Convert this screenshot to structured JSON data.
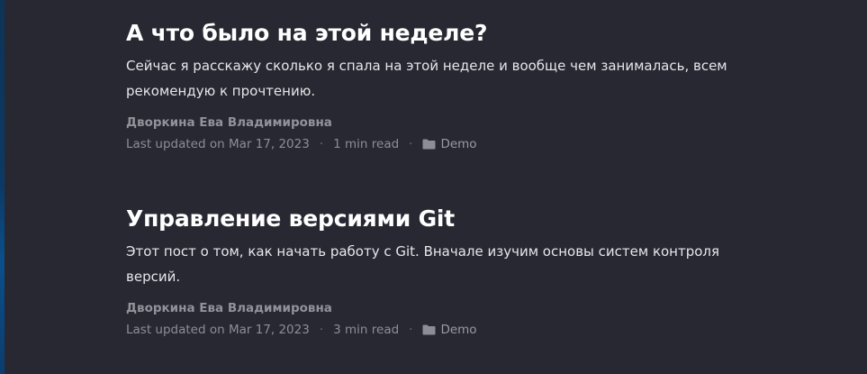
{
  "posts": [
    {
      "title": "А что было на этой неделе?",
      "excerpt": "Сейчас я расскажу сколько я спала на этой неделе и вообще чем занималась, всем рекомендую к прочтению.",
      "author": "Дворкина Ева Владимировна",
      "updated": "Last updated on Mar 17, 2023",
      "read_time": "1 min read",
      "category": "Demo",
      "separator": "·",
      "category_icon": "folder-icon"
    },
    {
      "title": "Управление версиями Git",
      "excerpt": "Этот пост о том, как начать работу с Git. Вначале изучим основы систем контроля версий.",
      "author": "Дворкина Ева Владимировна",
      "updated": "Last updated on Mar 17, 2023",
      "read_time": "3 min read",
      "category": "Demo",
      "separator": "·",
      "category_icon": "folder-icon"
    }
  ],
  "colors": {
    "background": "#272832",
    "title": "#ffffff",
    "excerpt": "#e6e6ea",
    "meta": "#8d8d95",
    "accent_edge": "#0a4f8c"
  }
}
